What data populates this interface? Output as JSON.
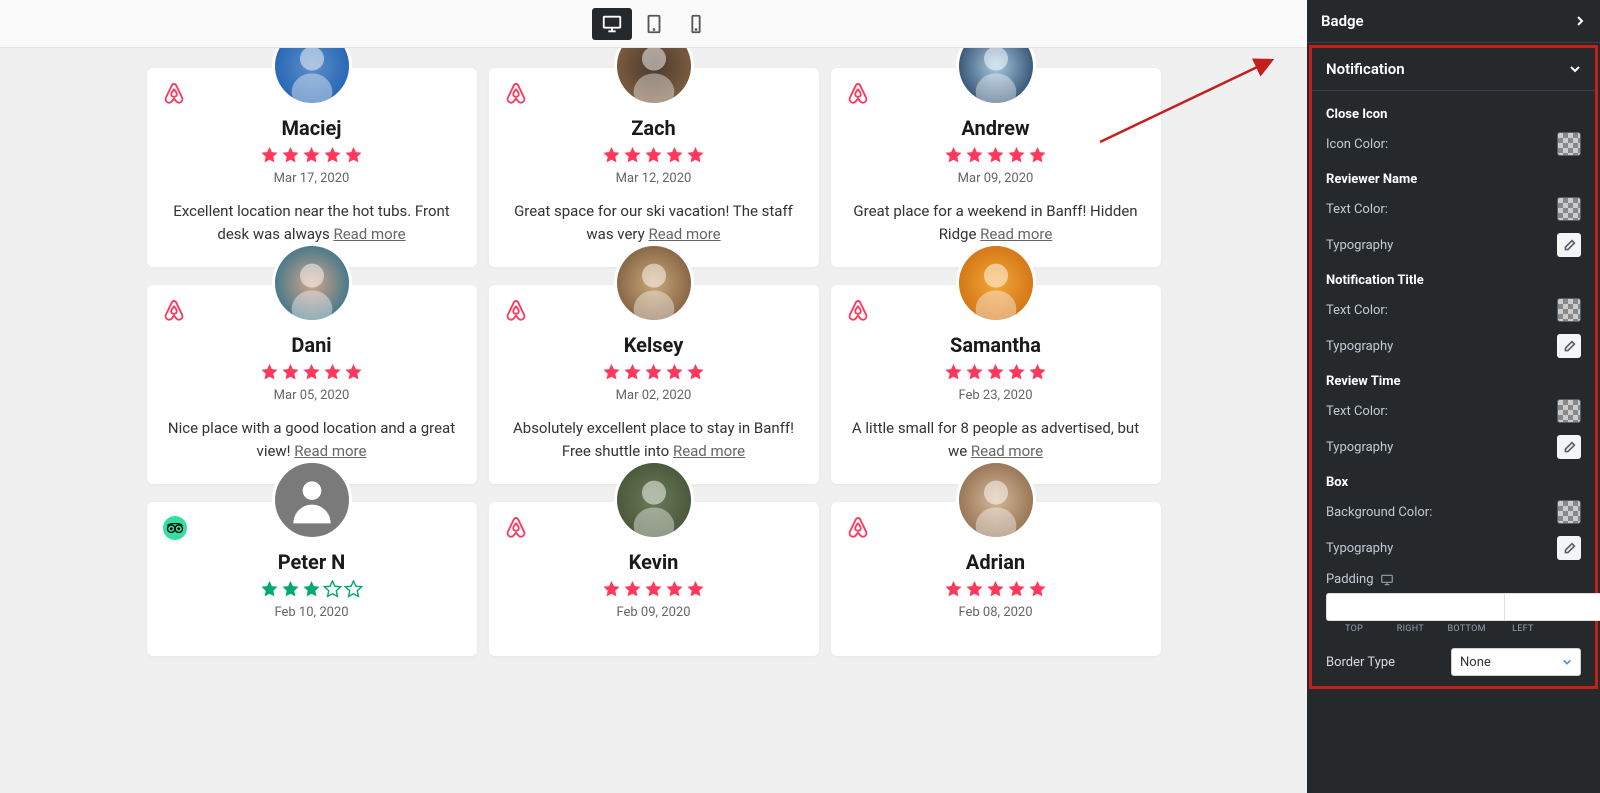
{
  "toolbar": {
    "devices": [
      "desktop",
      "tablet",
      "mobile"
    ],
    "active": 0
  },
  "reviews": [
    {
      "name": "Maciej",
      "date": "Mar 17, 2020",
      "text": "Excellent location near the hot tubs. Front desk was always ",
      "more": "Read more",
      "brand": "airbnb",
      "stars": 5,
      "star_style": "red",
      "avatar": "photo"
    },
    {
      "name": "Zach",
      "date": "Mar 12, 2020",
      "text": "Great space for our ski vacation! The staff was very ",
      "more": "Read more",
      "brand": "airbnb",
      "stars": 5,
      "star_style": "red",
      "avatar": "photo"
    },
    {
      "name": "Andrew",
      "date": "Mar 09, 2020",
      "text": "Great place for a weekend in Banff! Hidden Ridge ",
      "more": "Read more",
      "brand": "airbnb",
      "stars": 5,
      "star_style": "red",
      "avatar": "photo"
    },
    {
      "name": "Dani",
      "date": "Mar 05, 2020",
      "text": "Nice place with a good location and a great view! ",
      "more": "Read more",
      "brand": "airbnb",
      "stars": 5,
      "star_style": "red",
      "avatar": "photo"
    },
    {
      "name": "Kelsey",
      "date": "Mar 02, 2020",
      "text": "Absolutely excellent place to stay in Banff! Free shuttle into ",
      "more": "Read more",
      "brand": "airbnb",
      "stars": 5,
      "star_style": "red",
      "avatar": "photo"
    },
    {
      "name": "Samantha",
      "date": "Feb 23, 2020",
      "text": "A little small for 8 people as advertised, but we ",
      "more": "Read more",
      "brand": "airbnb",
      "stars": 5,
      "star_style": "red",
      "avatar": "photo"
    },
    {
      "name": "Peter N",
      "date": "Feb 10, 2020",
      "text": "",
      "more": "",
      "brand": "trip",
      "stars": 3,
      "star_style": "green",
      "avatar": "placeholder"
    },
    {
      "name": "Kevin",
      "date": "Feb 09, 2020",
      "text": "",
      "more": "",
      "brand": "airbnb",
      "stars": 5,
      "star_style": "red",
      "avatar": "photo"
    },
    {
      "name": "Adrian",
      "date": "Feb 08, 2020",
      "text": "",
      "more": "",
      "brand": "airbnb",
      "stars": 5,
      "star_style": "red",
      "avatar": "photo"
    }
  ],
  "sidebar": {
    "badge_header": "Badge",
    "notification_header": "Notification",
    "close_icon": {
      "title": "Close Icon",
      "icon_color": "Icon Color:"
    },
    "reviewer_name": {
      "title": "Reviewer Name",
      "text_color": "Text Color:",
      "typography": "Typography"
    },
    "notification_title": {
      "title": "Notification Title",
      "text_color": "Text Color:",
      "typography": "Typography"
    },
    "review_time": {
      "title": "Review Time",
      "text_color": "Text Color:",
      "typography": "Typography"
    },
    "box": {
      "title": "Box",
      "bg_color": "Background Color:",
      "typography": "Typography"
    },
    "padding": {
      "label": "Padding",
      "sides": [
        "TOP",
        "RIGHT",
        "BOTTOM",
        "LEFT"
      ]
    },
    "border": {
      "label": "Border Type",
      "value": "None"
    }
  },
  "avatar_colors": [
    [
      "#5b8ec4",
      "#2968b8"
    ],
    [
      "#4a3a2e",
      "#7a5a3e"
    ],
    [
      "#a8c8e0",
      "#3a5a7a"
    ],
    [
      "#d4a58a",
      "#4a7a8a"
    ],
    [
      "#c8a878",
      "#8a6848"
    ],
    [
      "#f4a838",
      "#d47818"
    ],
    [
      "#7a7a7a",
      "#7a7a7a"
    ],
    [
      "#6a7a5a",
      "#4a5a3a"
    ],
    [
      "#d4b89a",
      "#9a7858"
    ]
  ]
}
